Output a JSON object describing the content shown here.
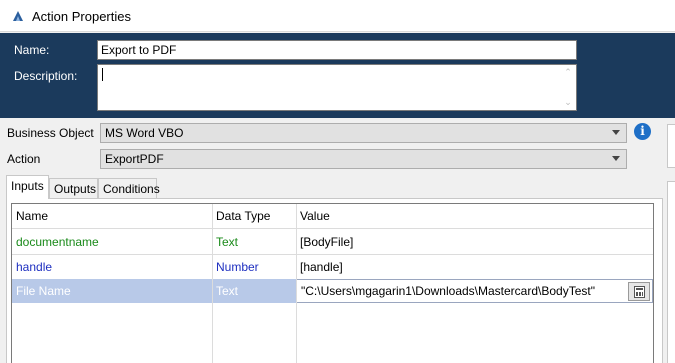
{
  "window": {
    "title": "Action Properties",
    "icon": "blueprism-action-icon"
  },
  "form": {
    "name_label": "Name:",
    "name_value": "Export to PDF",
    "description_label": "Description:",
    "description_value": "",
    "business_object_label": "Business Object",
    "business_object_value": "MS Word VBO",
    "action_label": "Action",
    "action_value": "ExportPDF"
  },
  "tabs": [
    {
      "label": "Inputs",
      "active": true
    },
    {
      "label": "Outputs",
      "active": false
    },
    {
      "label": "Conditions",
      "active": false
    }
  ],
  "grid": {
    "headers": [
      "Name",
      "Data Type",
      "Value"
    ],
    "rows": [
      {
        "name": "documentname",
        "type": "Text",
        "value": "[BodyFile]",
        "color": "#1a8a1a"
      },
      {
        "name": "handle",
        "type": "Number",
        "value": "[handle]",
        "color": "#1e2fc0"
      },
      {
        "name": "File Name",
        "type": "Text",
        "value": "\"C:\\Users\\mgagarin1\\Downloads\\Mastercard\\BodyTest\"",
        "selected": true
      }
    ]
  },
  "colors": {
    "header_panel": "#1b3a5c",
    "selected_row": "#b8c9e8",
    "text_type": "#1a8a1a",
    "number_type": "#1e2fc0"
  }
}
